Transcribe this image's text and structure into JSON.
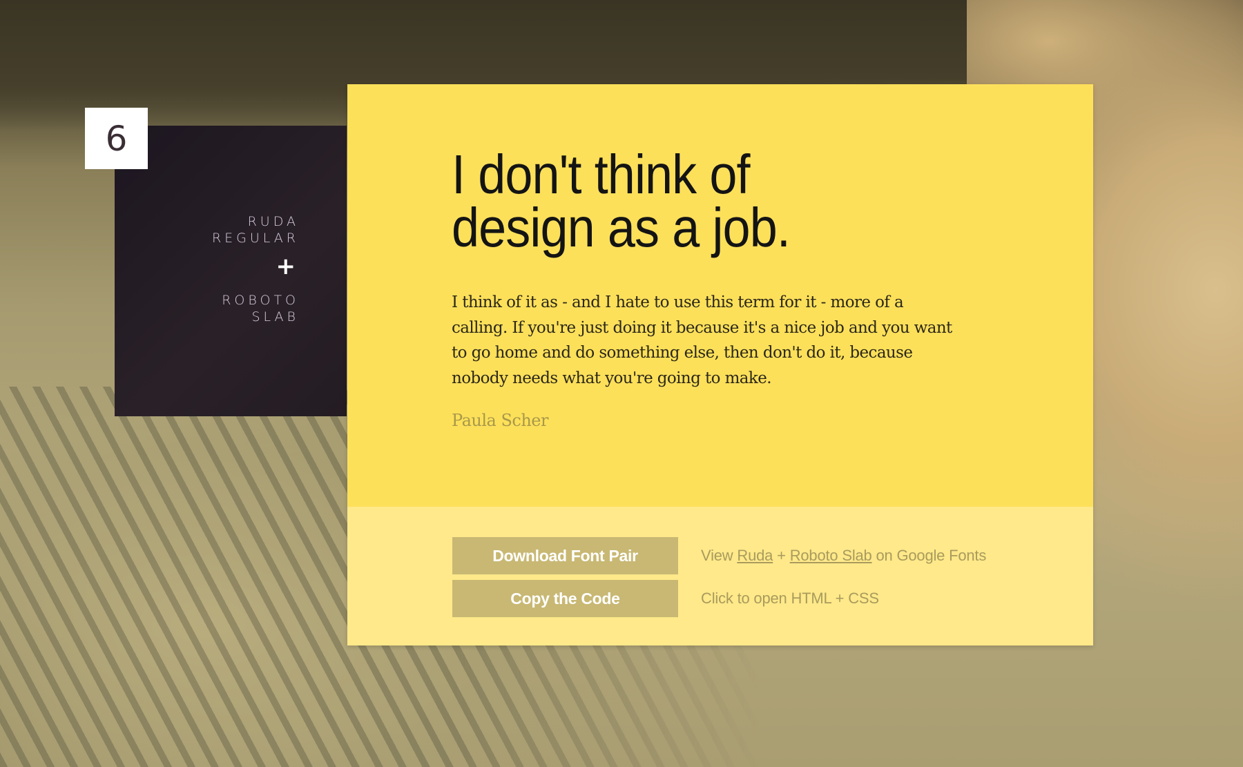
{
  "pair_number": "6",
  "font_pair": {
    "heading_font": [
      "RUDA",
      "REGULAR"
    ],
    "joiner": "+",
    "body_font": [
      "ROBOTO",
      "SLAB"
    ]
  },
  "quote": {
    "headline_line1": "I don't think of",
    "headline_line2": "design as a job.",
    "body": "I think of it as - and I hate to use this term for it - more of a calling. If you're just doing it because it's a nice job and you want to go home and do something else, then don't do it, because nobody needs what you're going to make.",
    "author": "Paula Scher"
  },
  "actions": {
    "download_label": "Download Font Pair",
    "copy_label": "Copy the Code",
    "view_prefix": "View ",
    "view_link1": "Ruda",
    "view_joiner": " + ",
    "view_link2": "Roboto Slab",
    "view_suffix": " on Google Fonts",
    "copy_hint": "Click to open HTML + CSS"
  },
  "colors": {
    "card_yellow": "#fde05a",
    "footer_yellow": "#ffe98a",
    "button": "#c8b873",
    "panel_dark": "#231c22"
  }
}
